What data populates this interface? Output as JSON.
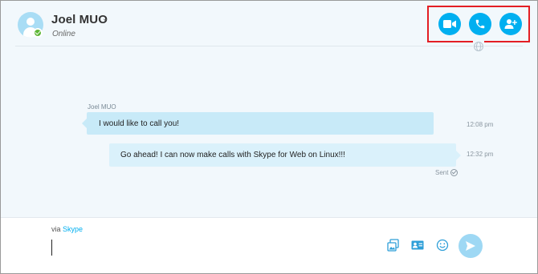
{
  "header": {
    "contact_name": "Joel MUO",
    "status": "Online",
    "actions": [
      {
        "name": "video-call",
        "icon": "video-camera-icon"
      },
      {
        "name": "audio-call",
        "icon": "phone-icon"
      },
      {
        "name": "add-people",
        "icon": "add-person-icon"
      }
    ],
    "highlight_color": "#e31e24",
    "accent_color": "#00aff0"
  },
  "conversation": {
    "messages": [
      {
        "sender": "Joel MUO",
        "text": "I would like to call you!",
        "time": "12:08 pm",
        "direction": "incoming"
      },
      {
        "sender": "",
        "text": "Go ahead! I can now make calls with Skype for Web on Linux!!!",
        "time": "12:32 pm",
        "direction": "outgoing",
        "status": "Sent"
      }
    ]
  },
  "compose": {
    "via_prefix": "via",
    "via_brand": "Skype",
    "input_value": "",
    "tools": [
      "media-icon",
      "contact-card-icon",
      "emoji-icon"
    ],
    "send_icon": "send-icon"
  }
}
